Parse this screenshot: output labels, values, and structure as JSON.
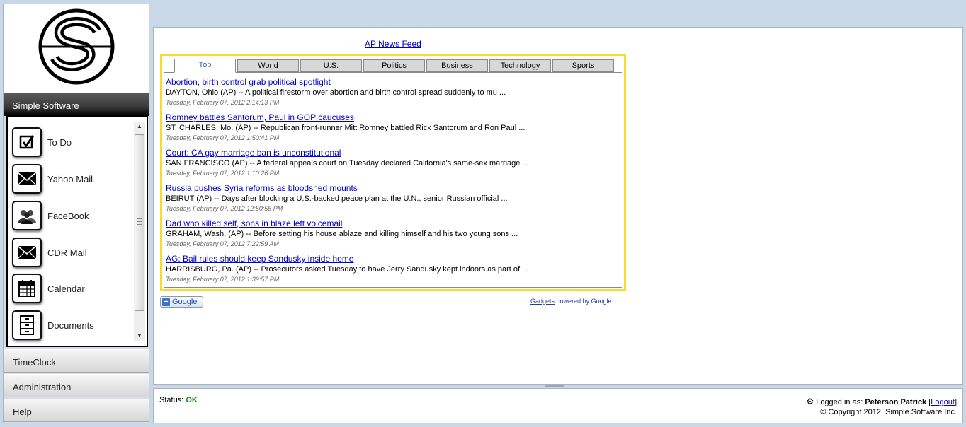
{
  "sidebar": {
    "app_title": "Simple Software",
    "apps": [
      {
        "label": "To Do",
        "icon": "checkbox-icon"
      },
      {
        "label": "Yahoo Mail",
        "icon": "envelope-icon"
      },
      {
        "label": "FaceBook",
        "icon": "people-icon"
      },
      {
        "label": "CDR Mail",
        "icon": "envelope-icon"
      },
      {
        "label": "Calendar",
        "icon": "calendar-icon"
      },
      {
        "label": "Documents",
        "icon": "file-cabinet-icon"
      }
    ],
    "nav": [
      "TimeClock",
      "Administration",
      "Help"
    ]
  },
  "main": {
    "feed_title": "AP News Feed",
    "tabs": [
      "Top",
      "World",
      "U.S.",
      "Politics",
      "Business",
      "Technology",
      "Sports"
    ],
    "active_tab": "Top",
    "stories": [
      {
        "title": "Abortion, birth control grab political spotlight",
        "snippet": "DAYTON, Ohio (AP) -- A political firestorm over abortion and birth control spread suddenly to mu ...",
        "date": "Tuesday, February 07, 2012 2:14:13 PM"
      },
      {
        "title": "Romney battles Santorum, Paul in GOP caucuses",
        "snippet": "ST. CHARLES, Mo. (AP) -- Republican front-runner Mitt Romney battled Rick Santorum and Ron Paul ...",
        "date": "Tuesday, February 07, 2012 1:50:41 PM"
      },
      {
        "title": "Court: CA gay marriage ban is unconstitutional",
        "snippet": "SAN FRANCISCO (AP) -- A federal appeals court on Tuesday declared California's same-sex marriage ...",
        "date": "Tuesday, February 07, 2012 1:10:26 PM"
      },
      {
        "title": "Russia pushes Syria reforms as bloodshed mounts",
        "snippet": "BEIRUT (AP) -- Days after blocking a U.S.-backed peace plan at the U.N., senior Russian official ...",
        "date": "Tuesday, February 07, 2012 12:50:58 PM"
      },
      {
        "title": "Dad who killed self, sons in blaze left voicemail",
        "snippet": "GRAHAM, Wash. (AP) -- Before setting his house ablaze and killing himself and his two young sons ...",
        "date": "Tuesday, February 07, 2012 7:22:59 AM"
      },
      {
        "title": "AG: Bail rules should keep Sandusky inside home",
        "snippet": "HARRISBURG, Pa. (AP) -- Prosecutors asked Tuesday to have Jerry Sandusky kept indoors as part of ...",
        "date": "Tuesday, February 07, 2012 1:39:57 PM"
      }
    ],
    "google_button": "Google",
    "gadgets_link": "Gadgets",
    "powered_by": "powered by Google"
  },
  "footer": {
    "status_label": "Status:",
    "status_value": "OK",
    "logged_in_label": "Logged in as:",
    "user_name": "Peterson Patrick",
    "logout": "Logout",
    "copyright": "© Copyright 2012, Simple Software Inc."
  },
  "colors": {
    "gadget_border": "#f7dc2c",
    "link": "#0000cc",
    "status_ok": "#1a8a1a",
    "active_tab_text": "#2256b6"
  }
}
